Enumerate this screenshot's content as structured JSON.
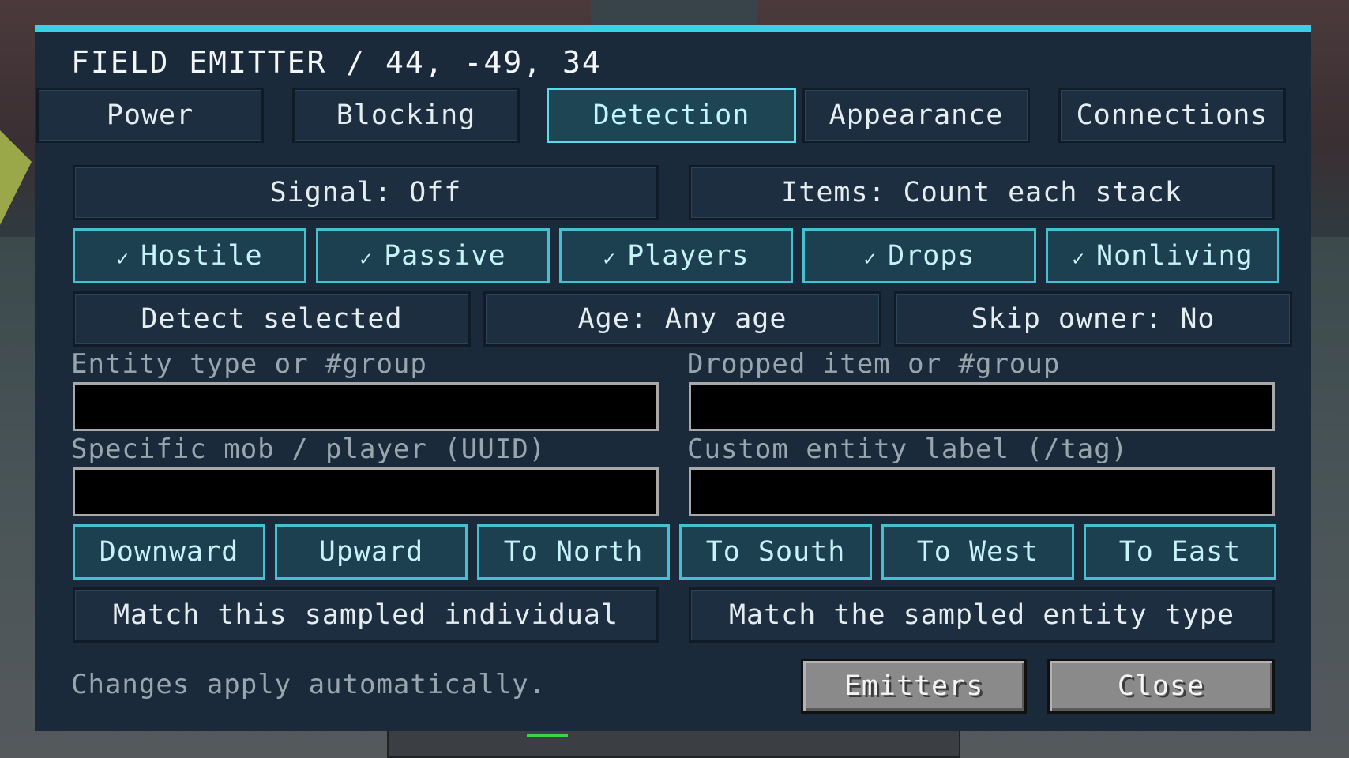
{
  "title": "FIELD EMITTER / 44, -49, 34",
  "tabs": [
    {
      "label": "Power",
      "active": false
    },
    {
      "label": "Blocking",
      "active": false
    },
    {
      "label": "Detection",
      "active": true
    },
    {
      "label": "Appearance",
      "active": false
    },
    {
      "label": "Connections",
      "active": false
    }
  ],
  "signal_button": "Signal: Off",
  "items_button": "Items: Count each stack",
  "filters": [
    {
      "label": "Hostile",
      "checked": true,
      "check": "✓"
    },
    {
      "label": "Passive",
      "checked": true,
      "check": "✓"
    },
    {
      "label": "Players",
      "checked": true,
      "check": "✓"
    },
    {
      "label": "Drops",
      "checked": true,
      "check": "✓"
    },
    {
      "label": "Nonliving",
      "checked": true,
      "check": "✓"
    }
  ],
  "options": {
    "detect_selected": "Detect selected",
    "age": "Age: Any age",
    "skip_owner": "Skip owner: No"
  },
  "fields": {
    "entity_type": {
      "label": "Entity type or #group",
      "value": ""
    },
    "dropped_item": {
      "label": "Dropped item or #group",
      "value": ""
    },
    "specific_mob": {
      "label": "Specific mob / player (UUID)",
      "value": ""
    },
    "custom_label": {
      "label": "Custom entity label (/tag)",
      "value": ""
    }
  },
  "directions": [
    "Downward",
    "Upward",
    "To North",
    "To South",
    "To West",
    "To East"
  ],
  "match_individual": "Match this sampled individual",
  "match_type": "Match the sampled entity type",
  "footer_note": "Changes apply automatically.",
  "emitters_button": "Emitters",
  "close_button": "Close",
  "colors": {
    "accent": "#3ad0e6",
    "panel": "#1b2a3b",
    "active_tab_border": "#5fd9ea"
  }
}
